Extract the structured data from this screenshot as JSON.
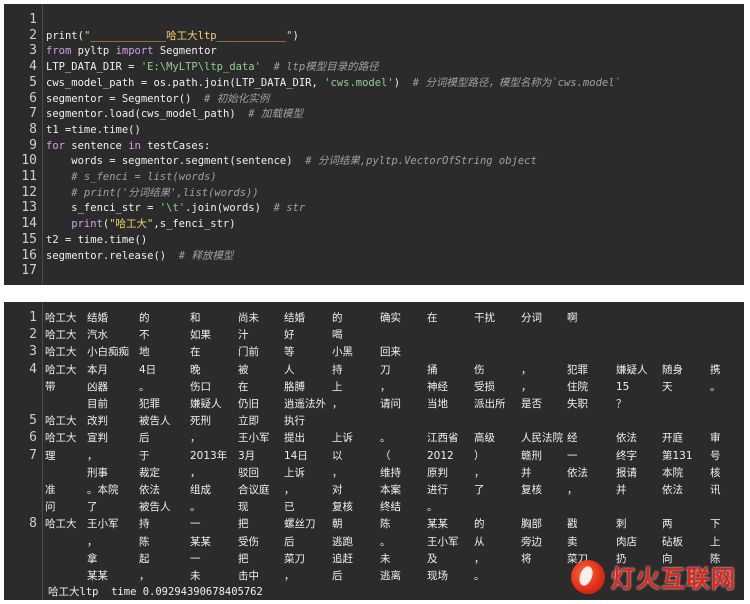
{
  "code": {
    "line_numbers": [
      "1",
      "2",
      "3",
      "4",
      "5",
      "6",
      "7",
      "8",
      "9",
      "10",
      "11",
      "12",
      "13",
      "14",
      "15",
      "16",
      "17"
    ],
    "lines": [
      [],
      [
        [
          "fn",
          "print("
        ],
        [
          "str2",
          "\"____________哈工大ltp___________\""
        ],
        [
          "fn",
          ")"
        ]
      ],
      [
        [
          "kw",
          "from"
        ],
        [
          "fn",
          " pyltp "
        ],
        [
          "kw",
          "import"
        ],
        [
          "fn",
          " Segmentor"
        ]
      ],
      [
        [
          "fn",
          "LTP_DATA_DIR = "
        ],
        [
          "str",
          "'E:\\MyLTP\\ltp_data'"
        ],
        [
          "cm",
          "  # ltp模型目录的路径"
        ]
      ],
      [
        [
          "fn",
          "cws_model_path = os.path.join(LTP_DATA_DIR, "
        ],
        [
          "str",
          "'cws.model'"
        ],
        [
          "fn",
          ")"
        ],
        [
          "cm",
          "  # 分词模型路径，模型名称为`cws.model`"
        ]
      ],
      [
        [
          "fn",
          "segmentor = Segmentor()"
        ],
        [
          "cm",
          "  # 初始化实例"
        ]
      ],
      [
        [
          "fn",
          "segmentor.load(cws_model_path)"
        ],
        [
          "cm",
          "  # 加载模型"
        ]
      ],
      [
        [
          "fn",
          "t1 =time.time()"
        ]
      ],
      [
        [
          "kw",
          "for"
        ],
        [
          "fn",
          " sentence "
        ],
        [
          "kw",
          "in"
        ],
        [
          "fn",
          " testCases:"
        ]
      ],
      [
        [
          "fn",
          "    words = segmentor.segment(sentence)"
        ],
        [
          "cm",
          "  # 分词结果,pyltp.VectorOfString object"
        ]
      ],
      [
        [
          "cm",
          "    # s_fenci = list(words)"
        ]
      ],
      [
        [
          "cm",
          "    # print('分词结果',list(words))"
        ]
      ],
      [
        [
          "fn",
          "    s_fenci_str = "
        ],
        [
          "str",
          "'\\t'"
        ],
        [
          "fn",
          ".join(words)"
        ],
        [
          "cm",
          "  # str"
        ]
      ],
      [
        [
          "kw",
          "    print"
        ],
        [
          "fn",
          "("
        ],
        [
          "str2",
          "\"哈工大\""
        ],
        [
          "fn",
          ",s_fenci_str)"
        ]
      ],
      [
        [
          "fn",
          "t2 = time.time()"
        ]
      ],
      [
        [
          "fn",
          "segmentor.release()"
        ],
        [
          "cm",
          "  # 释放模型"
        ]
      ],
      []
    ]
  },
  "output": {
    "line_numbers": [
      "1",
      "2",
      "3",
      "4",
      "5",
      "6",
      "7",
      "8"
    ],
    "rows": [
      [
        "哈工大",
        "结婚",
        "的",
        "和",
        "尚未",
        "结婚",
        "的",
        "确实",
        "在",
        "干扰",
        "分词",
        "啊"
      ],
      [
        "哈工大",
        "汽水",
        "不",
        "如果",
        "汁",
        "好",
        "喝"
      ],
      [
        "哈工大",
        "小白痴痴",
        "地",
        "在",
        "门前",
        "等",
        "小黑",
        "回来"
      ],
      [
        "哈工大",
        "本月",
        "4日",
        "晚",
        "被",
        "人",
        "持",
        "刀",
        "捅",
        "伤",
        "，",
        "犯罪",
        "嫌疑人",
        "随身",
        "携"
      ],
      [
        "带",
        "凶器",
        "。",
        "伤口",
        "在",
        "胳膊",
        "上",
        "，",
        "神经",
        "受损",
        "，",
        "住院",
        "15",
        "天",
        "。"
      ],
      [
        "",
        "目前",
        "犯罪",
        "嫌疑人",
        "仍旧",
        "逍遥法外",
        "，",
        "请问",
        "当地",
        "派出所",
        "是否",
        "失职",
        "？"
      ],
      [
        "哈工大",
        "改判",
        "被告人",
        "死刑",
        "立即",
        "执行"
      ],
      [
        "哈工大",
        "宣判",
        "后",
        "，",
        "王小军",
        "提出",
        "上诉",
        "。",
        "江西省",
        "高级",
        "人民法院",
        "经",
        "依法",
        "开庭",
        "审"
      ],
      [
        "理",
        "，",
        "于",
        "2013年",
        "3月",
        "14日",
        "以",
        "（",
        "2012",
        "）",
        "赣刑",
        "一",
        "终字",
        "第131",
        "号"
      ],
      [
        "",
        "刑事",
        "裁定",
        "，",
        "驳回",
        "上诉",
        "，",
        "维持",
        "原判",
        "，",
        "并",
        "依法",
        "报请",
        "本院",
        "核"
      ],
      [
        "准",
        "。本院",
        "依法",
        "组成",
        "合议庭",
        "，",
        "对",
        "本案",
        "进行",
        "了",
        "复核",
        "，",
        "并",
        "依法",
        "讯"
      ],
      [
        "问",
        "了",
        "被告人",
        "。",
        "现",
        "已",
        "复核",
        "终结",
        "。"
      ],
      [
        "哈工大",
        "王小军",
        "持",
        "一",
        "把",
        "螺丝刀",
        "朝",
        "陈",
        "某某",
        "的",
        "胸部",
        "戳",
        "刺",
        "两",
        "下"
      ],
      [
        "",
        "，",
        "陈",
        "某某",
        "受伤",
        "后",
        "逃跑",
        "。",
        "王小军",
        "从",
        "旁边",
        "卖",
        "肉店",
        "砧板",
        "上"
      ],
      [
        "",
        "拿",
        "起",
        "一",
        "把",
        "菜刀",
        "追赶",
        "未",
        "及",
        "，",
        "将",
        "菜刀",
        "扔",
        "向",
        "陈"
      ],
      [
        "",
        "某某",
        "，",
        "未",
        "击中",
        "，",
        "后",
        "逃离",
        "现场",
        "。"
      ]
    ],
    "time_line": "哈工大ltp  time 0.09294390678405762"
  },
  "watermark": {
    "text": "灯火互联网",
    "icon": "flame-logo-icon"
  }
}
